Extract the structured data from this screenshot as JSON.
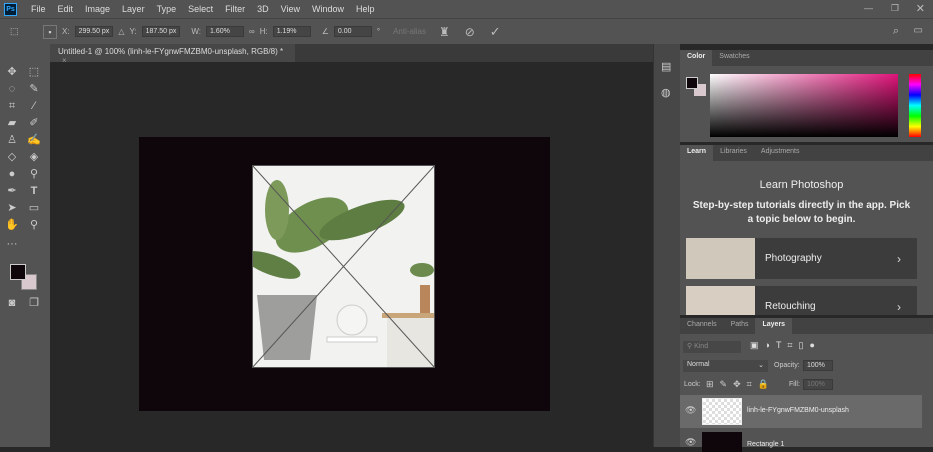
{
  "app": {
    "logo": "Ps"
  },
  "menu": [
    "File",
    "Edit",
    "Image",
    "Layer",
    "Type",
    "Select",
    "Filter",
    "3D",
    "View",
    "Window",
    "Help"
  ],
  "options": {
    "x_label": "X:",
    "x": "299.50 px",
    "y_label": "Y:",
    "y": "187.50 px",
    "w_label": "W:",
    "w": "1.60%",
    "h_label": "H:",
    "h": "1.19%",
    "angle": "0.00",
    "degree": "°",
    "anti_alias": "Anti-alias"
  },
  "document_tab": {
    "title": "Untitled-1 @ 100% (linh-le-FYgnwFMZBM0-unsplash, RGB/8) *",
    "close": "×"
  },
  "color_panel": {
    "tabs": [
      "Color",
      "Swatches"
    ],
    "hue_color": "#e0147a"
  },
  "learn_panel": {
    "tabs": [
      "Learn",
      "Libraries",
      "Adjustments"
    ],
    "title": "Learn Photoshop",
    "description": "Step-by-step tutorials directly in the app. Pick a topic below to begin.",
    "cards": [
      {
        "label": "Photography"
      },
      {
        "label": "Retouching"
      }
    ]
  },
  "layers_panel": {
    "tabs": [
      "Channels",
      "Paths",
      "Layers"
    ],
    "filter_placeholder": "Kind",
    "blend_mode": "Normal",
    "opacity_label": "Opacity:",
    "opacity": "100%",
    "lock_label": "Lock:",
    "fill_label": "Fill:",
    "fill": "100%",
    "layers": [
      {
        "name": "linh-le-FYgnwFMZBM0-unsplash",
        "selected": true
      },
      {
        "name": "Rectangle 1",
        "selected": false
      }
    ]
  }
}
